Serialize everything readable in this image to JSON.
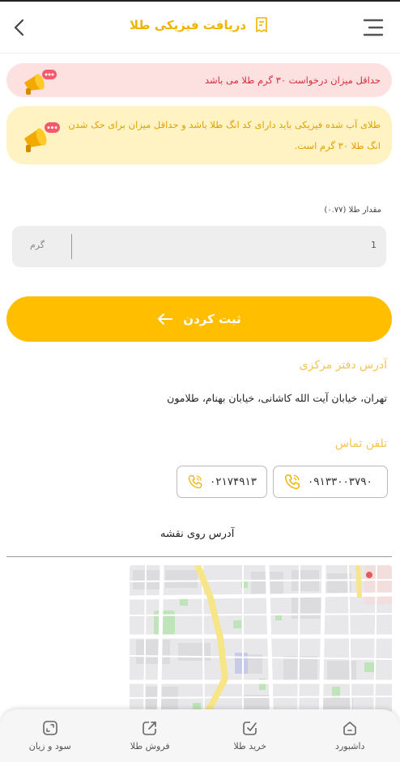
{
  "header": {
    "title": "دریافت فیزیکی طلا",
    "title_color": "#f0b400"
  },
  "alerts": {
    "min_request": "حداقل میزان درخواست ۳۰ گرم طلا می باشد",
    "physical_gold_line1": "طلای آب شده فیزیکی باید دارای کد انگ طلا باشد و حداقل میزان برای حک شدن",
    "physical_gold_line2": "انگ طلا ۳۰ گرم است."
  },
  "form": {
    "amount_label": "مقدار طلا (۰.۷۷)",
    "amount_value": "1",
    "unit": "گرم",
    "submit_label": "ثبت کردن"
  },
  "contact": {
    "address_title": "آدرس دفتر مرکزی",
    "address": "تهران، خیابان آیت الله کاشانی، خیابان بهنام، طلامون",
    "phone_title": "تلفن تماس",
    "phones": [
      "۰۹۱۳۳۰۰۳۷۹۰",
      "۰۲۱۷۴۹۱۳"
    ],
    "map_title": "آدرس روی نقشه"
  },
  "bottom_nav": [
    {
      "label": "سود و زیان",
      "icon": "expand-icon"
    },
    {
      "label": "فروش طلا",
      "icon": "share-out-icon"
    },
    {
      "label": "خرید طلا",
      "icon": "buy-check-icon"
    },
    {
      "label": "داشبورد",
      "icon": "home-icon"
    }
  ],
  "colors": {
    "accent": "#ffbf00",
    "pink_alert_bg": "#fde1e1",
    "pink_alert_text": "#d62b3b",
    "yellow_alert_bg": "#fff3c4",
    "yellow_alert_text": "#e0a100"
  }
}
